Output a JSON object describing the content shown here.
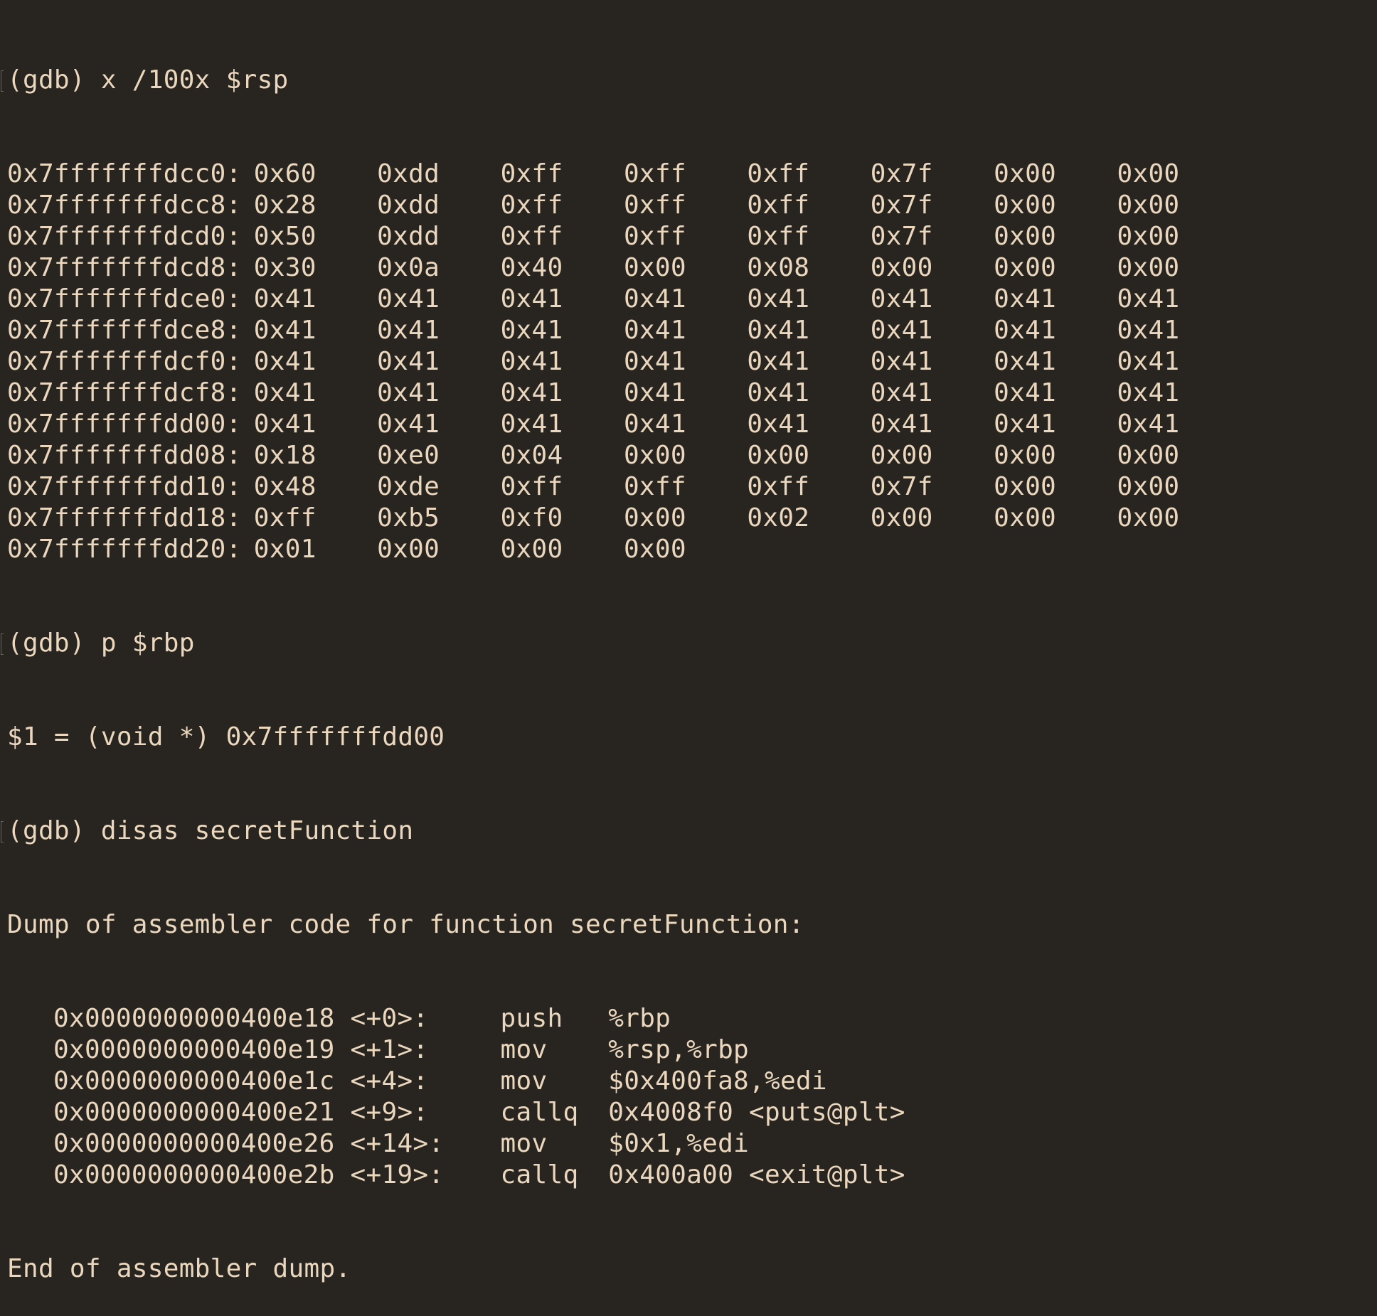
{
  "cmd1": "(gdb) x /100x $rsp",
  "memory": [
    {
      "addr": "0x7fffffffdcc0:",
      "bytes": [
        "0x60",
        "0xdd",
        "0xff",
        "0xff",
        "0xff",
        "0x7f",
        "0x00",
        "0x00"
      ]
    },
    {
      "addr": "0x7fffffffdcc8:",
      "bytes": [
        "0x28",
        "0xdd",
        "0xff",
        "0xff",
        "0xff",
        "0x7f",
        "0x00",
        "0x00"
      ]
    },
    {
      "addr": "0x7fffffffdcd0:",
      "bytes": [
        "0x50",
        "0xdd",
        "0xff",
        "0xff",
        "0xff",
        "0x7f",
        "0x00",
        "0x00"
      ]
    },
    {
      "addr": "0x7fffffffdcd8:",
      "bytes": [
        "0x30",
        "0x0a",
        "0x40",
        "0x00",
        "0x08",
        "0x00",
        "0x00",
        "0x00"
      ]
    },
    {
      "addr": "0x7fffffffdce0:",
      "bytes": [
        "0x41",
        "0x41",
        "0x41",
        "0x41",
        "0x41",
        "0x41",
        "0x41",
        "0x41"
      ]
    },
    {
      "addr": "0x7fffffffdce8:",
      "bytes": [
        "0x41",
        "0x41",
        "0x41",
        "0x41",
        "0x41",
        "0x41",
        "0x41",
        "0x41"
      ]
    },
    {
      "addr": "0x7fffffffdcf0:",
      "bytes": [
        "0x41",
        "0x41",
        "0x41",
        "0x41",
        "0x41",
        "0x41",
        "0x41",
        "0x41"
      ]
    },
    {
      "addr": "0x7fffffffdcf8:",
      "bytes": [
        "0x41",
        "0x41",
        "0x41",
        "0x41",
        "0x41",
        "0x41",
        "0x41",
        "0x41"
      ]
    },
    {
      "addr": "0x7fffffffdd00:",
      "bytes": [
        "0x41",
        "0x41",
        "0x41",
        "0x41",
        "0x41",
        "0x41",
        "0x41",
        "0x41"
      ]
    },
    {
      "addr": "0x7fffffffdd08:",
      "bytes": [
        "0x18",
        "0xe0",
        "0x04",
        "0x00",
        "0x00",
        "0x00",
        "0x00",
        "0x00"
      ]
    },
    {
      "addr": "0x7fffffffdd10:",
      "bytes": [
        "0x48",
        "0xde",
        "0xff",
        "0xff",
        "0xff",
        "0x7f",
        "0x00",
        "0x00"
      ]
    },
    {
      "addr": "0x7fffffffdd18:",
      "bytes": [
        "0xff",
        "0xb5",
        "0xf0",
        "0x00",
        "0x02",
        "0x00",
        "0x00",
        "0x00"
      ]
    },
    {
      "addr": "0x7fffffffdd20:",
      "bytes": [
        "0x01",
        "0x00",
        "0x00",
        "0x00"
      ]
    }
  ],
  "cmd2": "(gdb) p $rbp",
  "result2": "$1 = (void *) 0x7fffffffdd00",
  "cmd3": "(gdb) disas secretFunction",
  "dump_header": "Dump of assembler code for function secretFunction:",
  "disas": [
    {
      "addr": "0x0000000000400e18 <+0>:",
      "mn": "push",
      "op": "%rbp"
    },
    {
      "addr": "0x0000000000400e19 <+1>:",
      "mn": "mov",
      "op": "%rsp,%rbp"
    },
    {
      "addr": "0x0000000000400e1c <+4>:",
      "mn": "mov",
      "op": "$0x400fa8,%edi"
    },
    {
      "addr": "0x0000000000400e21 <+9>:",
      "mn": "callq",
      "op": "0x4008f0 <puts@plt>"
    },
    {
      "addr": "0x0000000000400e26 <+14>:",
      "mn": "mov",
      "op": "$0x1,%edi"
    },
    {
      "addr": "0x0000000000400e2b <+19>:",
      "mn": "callq",
      "op": "0x400a00 <exit@plt>"
    }
  ],
  "dump_footer": "End of assembler dump."
}
